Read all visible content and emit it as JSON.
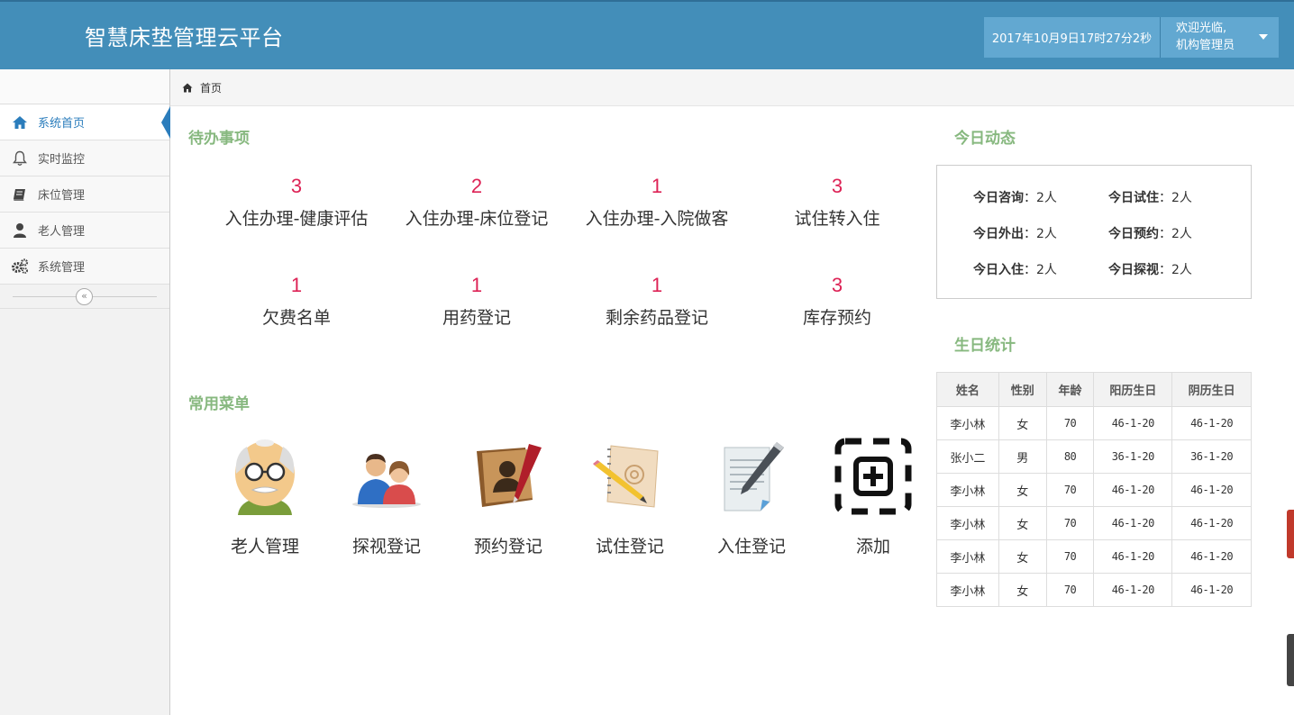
{
  "header": {
    "title": "智慧床垫管理云平台",
    "datetime": "2017年10月9日17时27分2秒",
    "welcome": "欢迎光临,",
    "role": "机构管理员"
  },
  "sidebar": {
    "items": [
      {
        "label": "系统首页",
        "icon": "home-icon"
      },
      {
        "label": "实时监控",
        "icon": "bell-icon"
      },
      {
        "label": "床位管理",
        "icon": "book-icon"
      },
      {
        "label": "老人管理",
        "icon": "user-icon"
      },
      {
        "label": "系统管理",
        "icon": "cogs-icon"
      }
    ],
    "collapse": "«"
  },
  "breadcrumb": {
    "home": "首页"
  },
  "todo": {
    "title": "待办事项",
    "items": [
      {
        "count": "3",
        "label": "入住办理-健康评估"
      },
      {
        "count": "2",
        "label": "入住办理-床位登记"
      },
      {
        "count": "1",
        "label": "入住办理-入院做客"
      },
      {
        "count": "3",
        "label": "试住转入住"
      },
      {
        "count": "1",
        "label": "欠费名单"
      },
      {
        "count": "1",
        "label": "用药登记"
      },
      {
        "count": "1",
        "label": "剩余药品登记"
      },
      {
        "count": "3",
        "label": "库存预约"
      }
    ]
  },
  "menu": {
    "title": "常用菜单",
    "items": [
      {
        "label": "老人管理",
        "icon": "elder-face-icon"
      },
      {
        "label": "探视登记",
        "icon": "visitors-icon"
      },
      {
        "label": "预约登记",
        "icon": "address-book-icon"
      },
      {
        "label": "试住登记",
        "icon": "notebook-pencil-icon"
      },
      {
        "label": "入住登记",
        "icon": "document-pen-icon"
      },
      {
        "label": "添加",
        "icon": "add-icon"
      }
    ]
  },
  "today": {
    "title": "今日动态",
    "stats": [
      {
        "label": "今日咨询",
        "value": "2人"
      },
      {
        "label": "今日试住",
        "value": "2人"
      },
      {
        "label": "今日外出",
        "value": "2人"
      },
      {
        "label": "今日预约",
        "value": "2人"
      },
      {
        "label": "今日入住",
        "value": "2人"
      },
      {
        "label": "今日探视",
        "value": "2人"
      }
    ]
  },
  "birthday": {
    "title": "生日统计",
    "headers": [
      "姓名",
      "性别",
      "年龄",
      "阳历生日",
      "阴历生日"
    ],
    "rows": [
      [
        "李小林",
        "女",
        "70",
        "46-1-20",
        "46-1-20"
      ],
      [
        "张小二",
        "男",
        "80",
        "36-1-20",
        "36-1-20"
      ],
      [
        "李小林",
        "女",
        "70",
        "46-1-20",
        "46-1-20"
      ],
      [
        "李小林",
        "女",
        "70",
        "46-1-20",
        "46-1-20"
      ],
      [
        "李小林",
        "女",
        "70",
        "46-1-20",
        "46-1-20"
      ],
      [
        "李小林",
        "女",
        "70",
        "46-1-20",
        "46-1-20"
      ]
    ]
  },
  "colors": {
    "header_bg": "#438eb9",
    "section_title": "#87b87f",
    "todo_count": "#dd2255",
    "active_nav": "#2b7dbc"
  }
}
